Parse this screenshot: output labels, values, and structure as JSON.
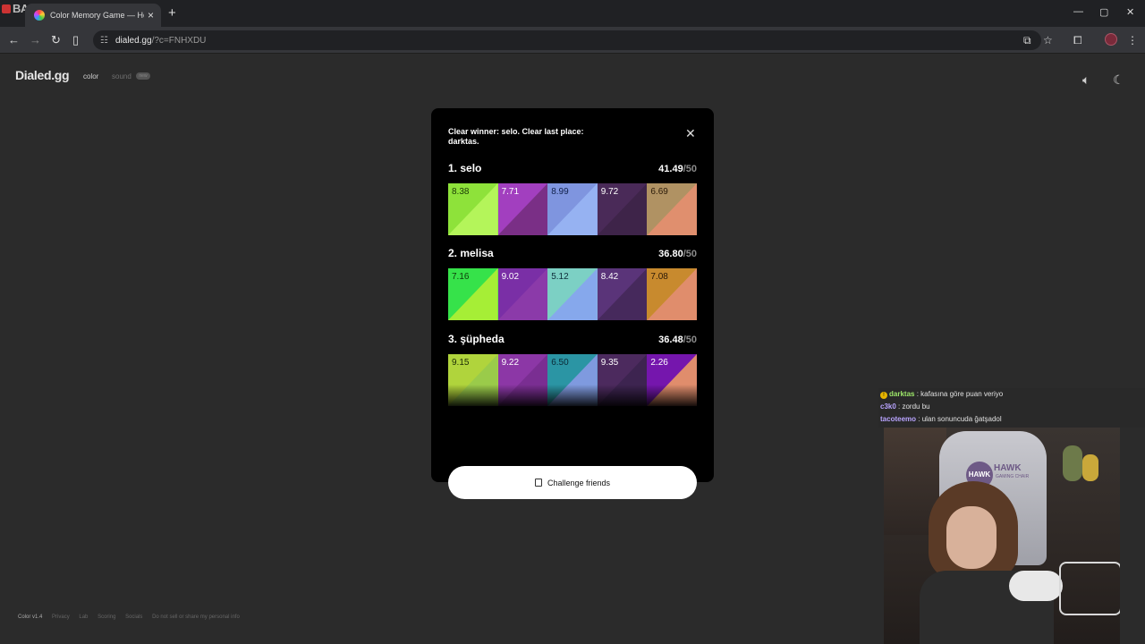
{
  "browser": {
    "overlay_logo": "BANoGame",
    "tab_title": "Color Memory Game — How W",
    "tab_close": "×",
    "new_tab": "+",
    "url_domain": "dialed.gg",
    "url_path": "/?c=FNHXDU",
    "window_controls": [
      "—",
      "▢",
      "✕"
    ]
  },
  "app": {
    "brand": "Dialed.gg",
    "mode_color": "color",
    "mode_sound": "sound",
    "mode_badge": "new"
  },
  "modal": {
    "headline": "Clear winner: selo. Clear last place: darktas.",
    "challenge_label": "Challenge friends",
    "players": [
      {
        "name": "1. selo",
        "score": "41.49",
        "max": "/50",
        "tiles": [
          {
            "value": "8.38",
            "text_color": "#1b3a06",
            "target": "#8ee23a",
            "guess": "#b4f55a"
          },
          {
            "value": "7.71",
            "text_color": "#ffffff",
            "target": "#a23fbf",
            "guess": "#7a2f86"
          },
          {
            "value": "8.99",
            "text_color": "#10204a",
            "target": "#7f95df",
            "guess": "#96b2f2"
          },
          {
            "value": "9.72",
            "text_color": "#ffffff",
            "target": "#4a2a58",
            "guess": "#3e2449"
          },
          {
            "value": "6.69",
            "text_color": "#2a1a08",
            "target": "#b09263",
            "guess": "#e08f6e"
          }
        ]
      },
      {
        "name": "2. melisa",
        "score": "36.80",
        "max": "/50",
        "tiles": [
          {
            "value": "7.16",
            "text_color": "#0f3a0a",
            "target": "#36e24a",
            "guess": "#a6ee36"
          },
          {
            "value": "9.02",
            "text_color": "#ffffff",
            "target": "#7a2fa6",
            "guess": "#8b3aa9"
          },
          {
            "value": "5.12",
            "text_color": "#0e2c3a",
            "target": "#7cd0c4",
            "guess": "#86a8ec"
          },
          {
            "value": "8.42",
            "text_color": "#ffffff",
            "target": "#5a3479",
            "guess": "#46295c"
          },
          {
            "value": "7.08",
            "text_color": "#2a1808",
            "target": "#c88a2e",
            "guess": "#e08d6c"
          }
        ]
      },
      {
        "name": "3. şüpheda",
        "score": "36.48",
        "max": "/50",
        "tiles": [
          {
            "value": "9.15",
            "text_color": "#1c2c06",
            "target": "#b0d43c",
            "guess": "#9acb4a"
          },
          {
            "value": "9.22",
            "text_color": "#ffffff",
            "target": "#8c37a6",
            "guess": "#7a2e92"
          },
          {
            "value": "6.50",
            "text_color": "#0b2a36",
            "target": "#2b95a4",
            "guess": "#7f9adf"
          },
          {
            "value": "9.35",
            "text_color": "#ffffff",
            "target": "#4c2a5e",
            "guess": "#3d2450"
          },
          {
            "value": "2.26",
            "text_color": "#ffffff",
            "target": "#7516ad",
            "guess": "#e08d6c"
          }
        ]
      }
    ]
  },
  "footer": [
    "Color v1.4",
    "Privacy",
    "Lab",
    "Scoring",
    "Socials",
    "Do not sell or share my personal info"
  ],
  "chat": [
    {
      "user": "darktas",
      "user_color": "#9ee86a",
      "text": "kafasına göre puan veriyo",
      "alert": "!"
    },
    {
      "user": "c3k0",
      "user_color": "#b9a4ff",
      "text": "zordu bu"
    },
    {
      "user": "tacoteemo",
      "user_color": "#b9a4ff",
      "text": "ulan sonuncuda ğatşadol"
    }
  ],
  "webcam": {
    "chair_logo": "HAWK",
    "chair_text": "HAWK",
    "chair_sub": "GAMING CHAIR"
  }
}
